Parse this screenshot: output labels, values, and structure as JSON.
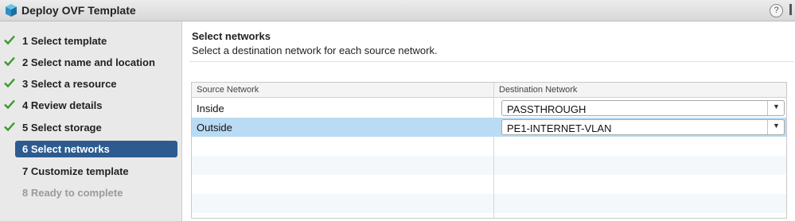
{
  "window": {
    "title": "Deploy OVF Template",
    "help_label": "?"
  },
  "steps": [
    {
      "number": "1",
      "label": "Select template",
      "state": "done"
    },
    {
      "number": "2",
      "label": "Select name and location",
      "state": "done"
    },
    {
      "number": "3",
      "label": "Select a resource",
      "state": "done"
    },
    {
      "number": "4",
      "label": "Review details",
      "state": "done"
    },
    {
      "number": "5",
      "label": "Select storage",
      "state": "done"
    },
    {
      "number": "6",
      "label": "Select networks",
      "state": "active"
    },
    {
      "number": "7",
      "label": "Customize template",
      "state": "pending"
    },
    {
      "number": "8",
      "label": "Ready to complete",
      "state": "disabled"
    }
  ],
  "main": {
    "title": "Select networks",
    "subtitle": "Select a destination network for each source network."
  },
  "table": {
    "columns": [
      "Source Network",
      "Destination Network"
    ],
    "rows": [
      {
        "source": "Inside",
        "destination": "PASSTHROUGH",
        "selected": false
      },
      {
        "source": "Outside",
        "destination": "PE1-INTERNET-VLAN",
        "selected": true
      }
    ]
  },
  "colors": {
    "accent": "#2d5b8f",
    "check": "#3a9a2a",
    "selected_row": "#b9dbf4"
  }
}
